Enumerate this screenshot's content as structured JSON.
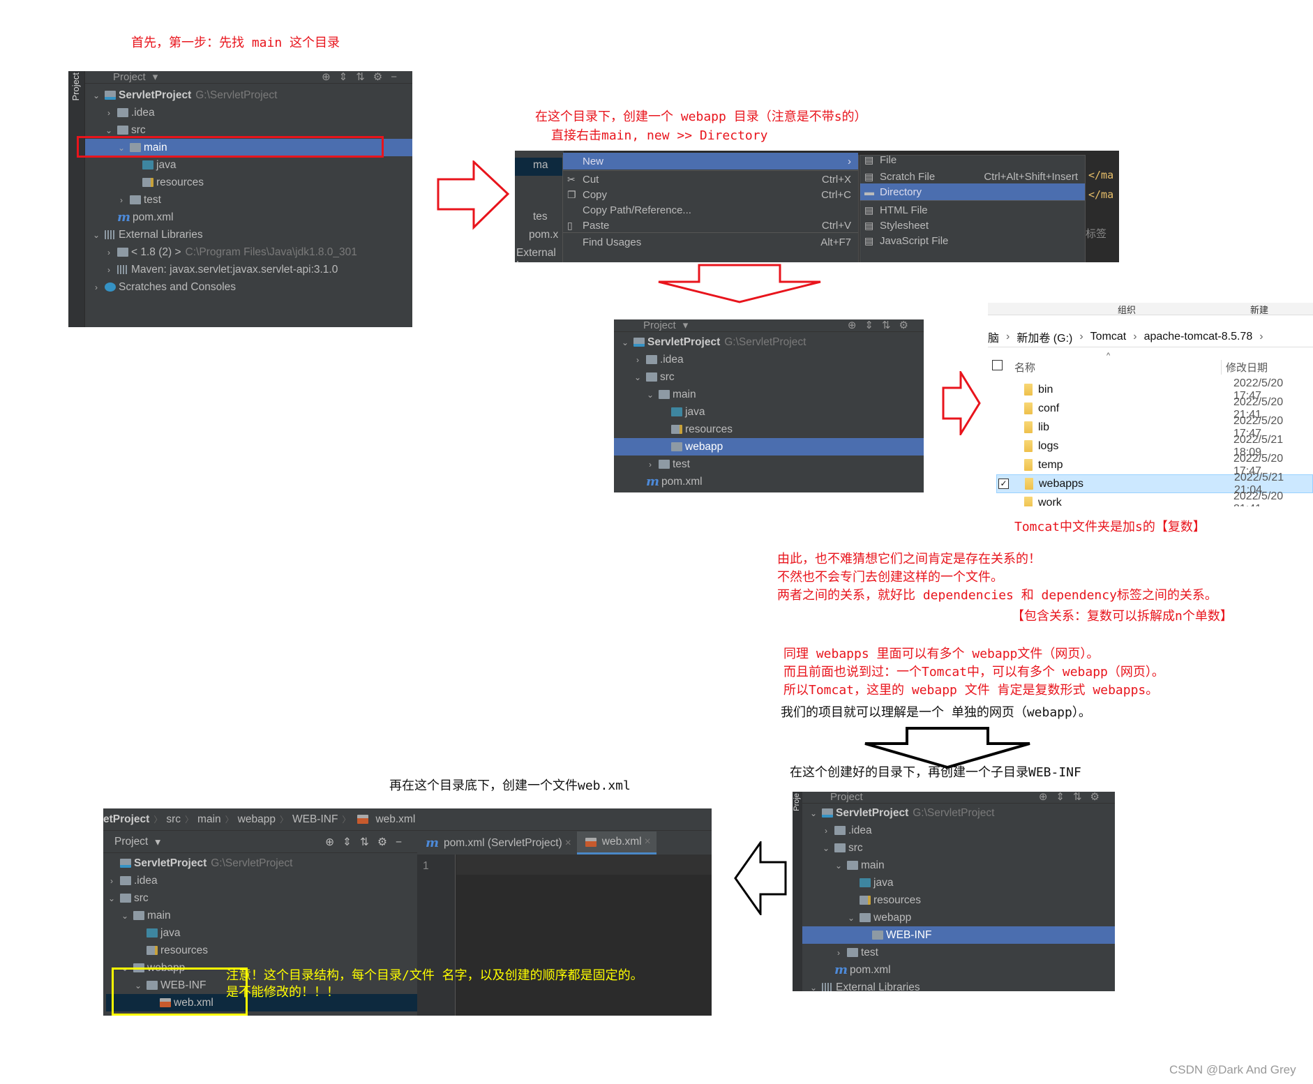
{
  "notes": {
    "step1": "首先，第一步：先找 main 这个目录",
    "step2_line1": "在这个目录下，创建一个 webapp 目录（注意是不带s的）",
    "step2_line2": "直接右击main, new >> Directory",
    "tomcat_plural": "Tomcat中文件夹是加s的【复数】",
    "relation": [
      "由此，也不难猜想它们之间肯定是存在关系的！",
      "不然也不会专门去创建这样的一个文件。",
      "两者之间的关系，就好比 dependencies 和 dependency标签之间的关系。",
      "【包含关系：复数可以拆解成n个单数】"
    ],
    "webapps": [
      "同理 webapps 里面可以有多个 webapp文件（网页）。",
      "而且前面也说到过：一个Tomcat中，可以有多个 webapp（网页）。",
      "所以Tomcat，这里的 webapp 文件 肯定是复数形式 webapps。"
    ],
    "single_webapp": "我们的项目就可以理解是一个 单独的网页（webapp）。",
    "create_webinf": "在这个创建好的目录下，再创建一个子目录WEB-INF",
    "create_webxml": "再在这个目录底下，创建一个文件web.xml",
    "warning_line1": "注意！这个目录结构，每个目录/文件 名字，以及创建的顺序都是固定的。",
    "warning_line2": "是不能修改的！！！",
    "watermark": "CSDN @Dark And Grey"
  },
  "colors": {
    "annotation": "#e8141c",
    "highlight_box_red": "#e8141c",
    "highlight_box_yellow": "#ffff00",
    "ide_selection": "#4b6eaf",
    "ide_bg": "#3c3f41"
  },
  "panel1": {
    "side_tab": "Project",
    "header": "Project",
    "tree": [
      {
        "depth": 0,
        "arrow": "v",
        "icon": "folder-module",
        "label": "ServletProject",
        "hint": "G:\\ServletProject",
        "bold": true
      },
      {
        "depth": 1,
        "arrow": ">",
        "icon": "folder",
        "label": ".idea"
      },
      {
        "depth": 1,
        "arrow": "v",
        "icon": "folder",
        "label": "src"
      },
      {
        "depth": 2,
        "arrow": "v",
        "icon": "folder",
        "label": "main",
        "selected": true
      },
      {
        "depth": 3,
        "icon": "folder-java",
        "label": "java"
      },
      {
        "depth": 3,
        "icon": "folder-res",
        "label": "resources"
      },
      {
        "depth": 2,
        "arrow": ">",
        "icon": "folder",
        "label": "test"
      },
      {
        "depth": 1,
        "icon": "maven",
        "label": "pom.xml"
      },
      {
        "depth": 0,
        "arrow": "v",
        "icon": "libs",
        "label": "External Libraries"
      },
      {
        "depth": 1,
        "arrow": ">",
        "icon": "folder",
        "label": "< 1.8 (2) >",
        "hint": "C:\\Program Files\\Java\\jdk1.8.0_301"
      },
      {
        "depth": 1,
        "arrow": ">",
        "icon": "libs",
        "label": "Maven: javax.servlet:javax.servlet-api:3.1.0"
      },
      {
        "depth": 0,
        "arrow": ">",
        "icon": "scratch",
        "label": "Scratches and Consoles"
      }
    ]
  },
  "popup": {
    "tree": [
      "ma",
      "tes",
      "pom.x",
      "External L"
    ],
    "editor_text": [
      "</ma",
      "</ma",
      "标签"
    ],
    "menu": [
      {
        "label": "New",
        "selected": true,
        "submenu": true
      },
      {
        "label": "Cut",
        "shortcut": "Ctrl+X",
        "icon": "scissors-icon"
      },
      {
        "label": "Copy",
        "shortcut": "Ctrl+C",
        "icon": "copy-icon"
      },
      {
        "label": "Copy Path/Reference..."
      },
      {
        "label": "Paste",
        "shortcut": "Ctrl+V",
        "icon": "paste-icon"
      },
      {
        "label": "Find Usages",
        "shortcut": "Alt+F7"
      }
    ],
    "submenu": [
      {
        "label": "File"
      },
      {
        "label": "Scratch File",
        "shortcut": "Ctrl+Alt+Shift+Insert"
      },
      {
        "label": "Directory",
        "selected": true
      },
      {
        "label": "HTML File"
      },
      {
        "label": "Stylesheet"
      },
      {
        "label": "JavaScript File"
      }
    ]
  },
  "panel3": {
    "header": "Project",
    "tree": [
      {
        "depth": 0,
        "arrow": "v",
        "icon": "folder-module",
        "label": "ServletProject",
        "hint": "G:\\ServletProject",
        "bold": true
      },
      {
        "depth": 1,
        "arrow": ">",
        "icon": "folder",
        "label": ".idea"
      },
      {
        "depth": 1,
        "arrow": "v",
        "icon": "folder",
        "label": "src"
      },
      {
        "depth": 2,
        "arrow": "v",
        "icon": "folder",
        "label": "main"
      },
      {
        "depth": 3,
        "icon": "folder-java",
        "label": "java"
      },
      {
        "depth": 3,
        "icon": "folder-res",
        "label": "resources"
      },
      {
        "depth": 3,
        "icon": "folder",
        "label": "webapp",
        "selected": true
      },
      {
        "depth": 2,
        "arrow": ">",
        "icon": "folder",
        "label": "test"
      },
      {
        "depth": 1,
        "icon": "maven",
        "label": "pom.xml"
      }
    ]
  },
  "explorer": {
    "toolbar": [
      "组织",
      "新建"
    ],
    "breadcrumb": [
      "脑",
      "新加卷 (G:)",
      "Tomcat",
      "apache-tomcat-8.5.78"
    ],
    "columns": {
      "name": "名称",
      "modified": "修改日期"
    },
    "rows": [
      {
        "name": "bin",
        "date": "2022/5/20 17:47"
      },
      {
        "name": "conf",
        "date": "2022/5/20 21:41"
      },
      {
        "name": "lib",
        "date": "2022/5/20 17:47"
      },
      {
        "name": "logs",
        "date": "2022/5/21 18:09"
      },
      {
        "name": "temp",
        "date": "2022/5/20 17:47"
      },
      {
        "name": "webapps",
        "date": "2022/5/21 21:04",
        "selected": true,
        "checked": true
      },
      {
        "name": "work",
        "date": "2022/5/20 21:41"
      }
    ]
  },
  "panel5": {
    "side_tab": "Proje",
    "header": "Project",
    "tree": [
      {
        "depth": 0,
        "arrow": "v",
        "icon": "folder-module",
        "label": "ServletProject",
        "hint": "G:\\ServletProject",
        "bold": true
      },
      {
        "depth": 1,
        "arrow": ">",
        "icon": "folder",
        "label": ".idea"
      },
      {
        "depth": 1,
        "arrow": "v",
        "icon": "folder",
        "label": "src"
      },
      {
        "depth": 2,
        "arrow": "v",
        "icon": "folder",
        "label": "main"
      },
      {
        "depth": 3,
        "icon": "folder-java",
        "label": "java"
      },
      {
        "depth": 3,
        "icon": "folder-res",
        "label": "resources"
      },
      {
        "depth": 3,
        "arrow": "v",
        "icon": "folder",
        "label": "webapp"
      },
      {
        "depth": 4,
        "icon": "folder",
        "label": "WEB-INF",
        "selected": true
      },
      {
        "depth": 2,
        "arrow": ">",
        "icon": "folder",
        "label": "test"
      },
      {
        "depth": 1,
        "icon": "maven",
        "label": "pom.xml"
      },
      {
        "depth": 0,
        "arrow": "v",
        "icon": "libs",
        "label": "External Libraries"
      }
    ]
  },
  "panel4": {
    "breadcrumb": [
      "etProject",
      "src",
      "main",
      "webapp",
      "WEB-INF",
      "web.xml"
    ],
    "header": "Project",
    "tabs": [
      {
        "label": "pom.xml (ServletProject)",
        "icon": "maven"
      },
      {
        "label": "web.xml",
        "icon": "xml",
        "active": true
      }
    ],
    "line_number": "1",
    "tree": [
      {
        "depth": 0,
        "icon": "folder-module",
        "label": "ServletProject",
        "hint": "G:\\ServletProject",
        "bold": true
      },
      {
        "depth": 0,
        "arrow": ">",
        "icon": "folder",
        "label": ".idea"
      },
      {
        "depth": 0,
        "arrow": "v",
        "icon": "folder",
        "label": "src"
      },
      {
        "depth": 1,
        "arrow": "v",
        "icon": "folder",
        "label": "main"
      },
      {
        "depth": 2,
        "icon": "folder-java",
        "label": "java"
      },
      {
        "depth": 2,
        "icon": "folder-res",
        "label": "resources"
      },
      {
        "depth": 1,
        "arrow": "v",
        "icon": "folder",
        "label": "webapp"
      },
      {
        "depth": 2,
        "arrow": "v",
        "icon": "folder",
        "label": "WEB-INF"
      },
      {
        "depth": 3,
        "icon": "xml",
        "label": "web.xml",
        "dark_selected": true
      }
    ]
  }
}
